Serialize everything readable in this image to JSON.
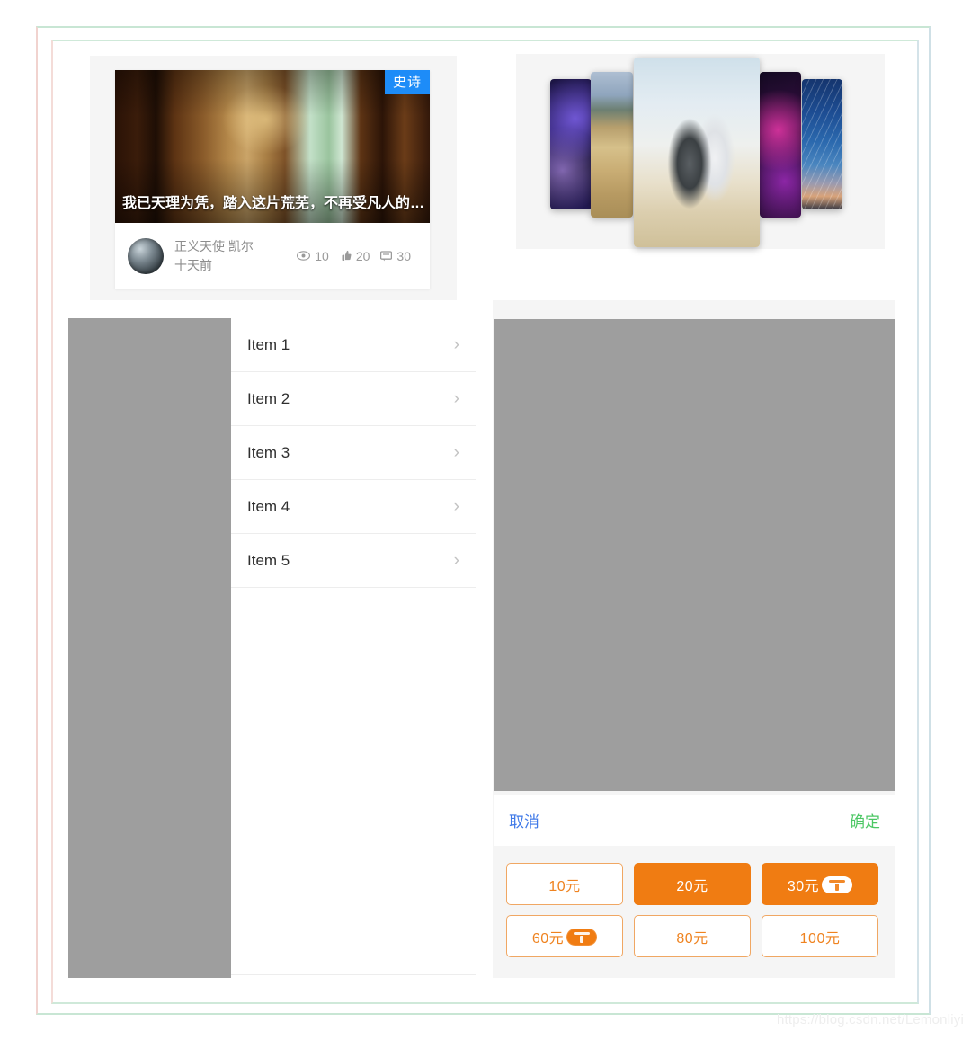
{
  "feed_card": {
    "badge": "史诗",
    "title": "我已天理为凭，踏入这片荒芜，不再受凡人的枷...",
    "author": "正义天使 凯尔",
    "time": "十天前",
    "stats": {
      "views_icon": "eye-icon",
      "views": "10",
      "likes_icon": "thumbs-up-icon",
      "likes": "20",
      "comments_icon": "comment-icon",
      "comments": "30"
    }
  },
  "carousel": {
    "cards": [
      {
        "name": "neon-city-left",
        "alt": "霓虹城市"
      },
      {
        "name": "wheat-field",
        "alt": "麦田"
      },
      {
        "name": "couple-center",
        "alt": "情侣"
      },
      {
        "name": "neon-city-right",
        "alt": "霓虹夜景"
      },
      {
        "name": "star-trails",
        "alt": "星轨"
      }
    ]
  },
  "list": {
    "items": [
      {
        "label": "Item 1",
        "chevron": "chevron-right-icon"
      },
      {
        "label": "Item 2",
        "chevron": "chevron-right-icon"
      },
      {
        "label": "Item 3",
        "chevron": "chevron-right-icon"
      },
      {
        "label": "Item 4",
        "chevron": "chevron-right-icon"
      },
      {
        "label": "Item 5",
        "chevron": "chevron-right-icon"
      }
    ]
  },
  "action_bar": {
    "cancel": "取消",
    "confirm": "确定"
  },
  "price_grid": {
    "options": [
      {
        "label": "10元",
        "selected": false,
        "badge": false
      },
      {
        "label": "20元",
        "selected": true,
        "badge": false
      },
      {
        "label": "30元",
        "selected": true,
        "badge": true
      },
      {
        "label": "60元",
        "selected": false,
        "badge": true
      },
      {
        "label": "80元",
        "selected": false,
        "badge": false
      },
      {
        "label": "100元",
        "selected": false,
        "badge": false
      }
    ]
  },
  "watermark": "https://blog.csdn.net/Lemonliyi",
  "colors": {
    "badge_blue": "#1d8cf8",
    "cancel_blue": "#3f79e8",
    "confirm_green": "#4cc764",
    "accent_orange": "#f07c12",
    "accent_orange_border": "#f0a763",
    "grey_placeholder": "#9e9e9e",
    "panel_grey": "#f5f5f5",
    "frame_green": "#c8e6d4",
    "frame_pink": "#f1d3cf"
  }
}
